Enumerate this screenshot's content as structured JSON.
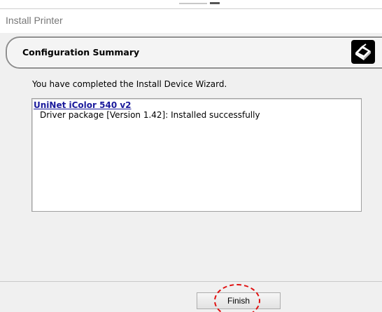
{
  "window": {
    "title": "Install Printer"
  },
  "banner": {
    "heading": "Configuration Summary",
    "icon": "printer-icon"
  },
  "main": {
    "message": "You have completed the Install Device Wizard."
  },
  "summary": {
    "device_name": "UniNet iColor 540 v2",
    "status_line": "Driver package [Version 1.42]: Installed successfully"
  },
  "footer": {
    "finish_label": "Finish",
    "highlight_color": "#e01010"
  }
}
